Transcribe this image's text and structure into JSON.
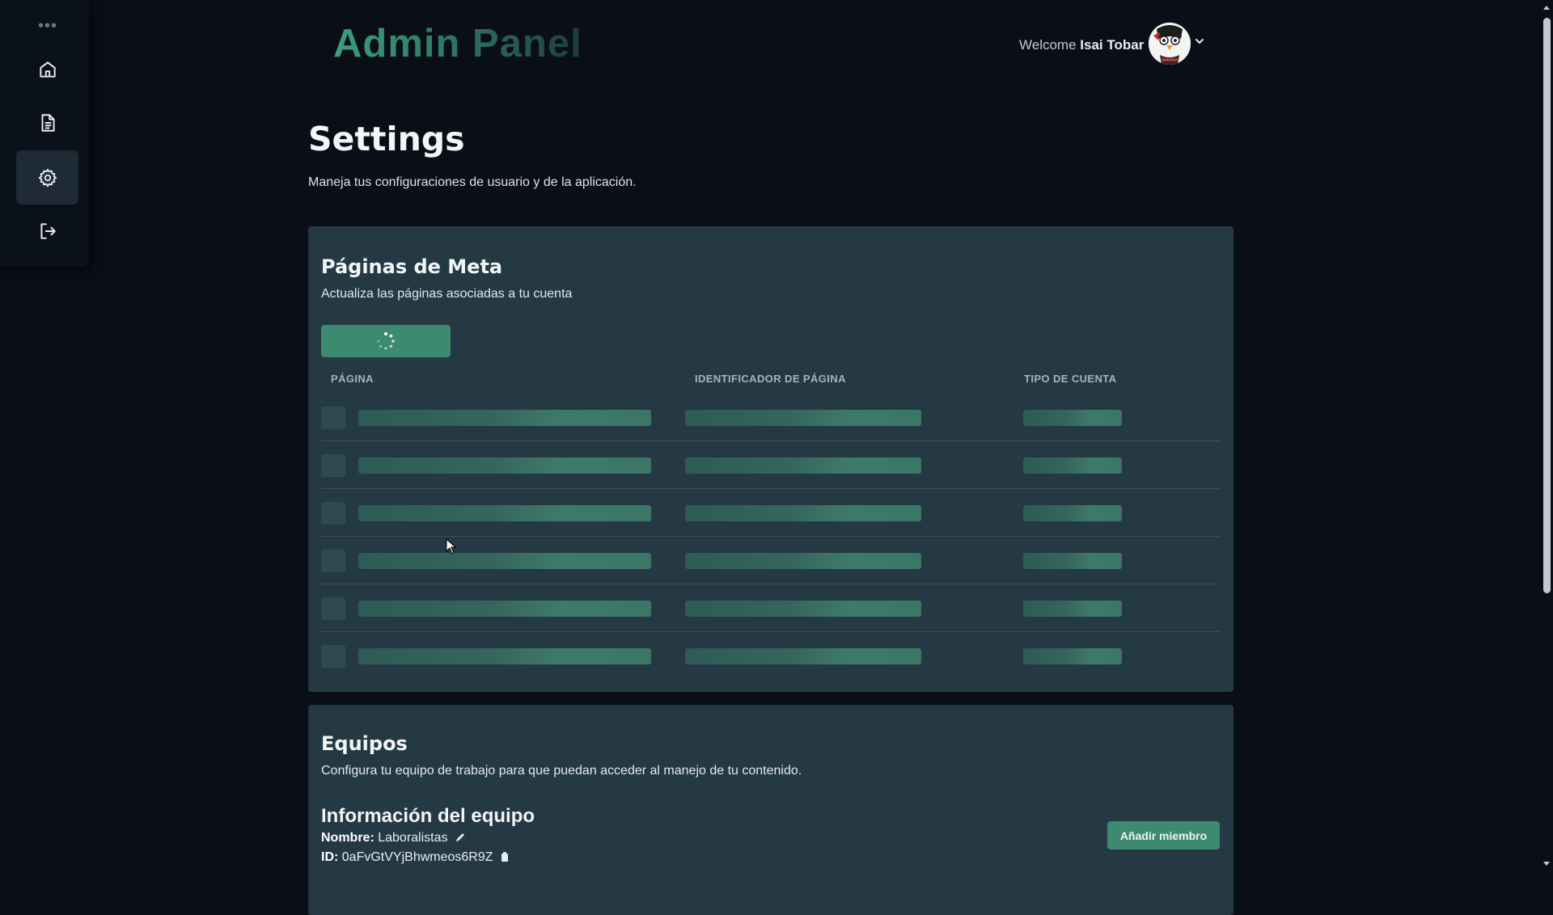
{
  "sidebar": {
    "more_label": "•••",
    "items": [
      {
        "name": "home",
        "icon": "home-icon"
      },
      {
        "name": "documents",
        "icon": "document-icon"
      },
      {
        "name": "settings",
        "icon": "gear-icon",
        "active": true
      },
      {
        "name": "logout",
        "icon": "logout-icon"
      }
    ]
  },
  "header": {
    "title": "Admin Panel",
    "welcome_prefix": "Welcome",
    "user_name": "Isai Tobar"
  },
  "page": {
    "title": "Settings",
    "subtitle": "Maneja tus configuraciones de usuario y de la aplicación."
  },
  "meta_pages": {
    "title": "Páginas de Meta",
    "description": "Actualiza las páginas asociadas a tu cuenta",
    "columns": [
      "PÁGINA",
      "IDENTIFICADOR DE PÁGINA",
      "TIPO DE CUENTA"
    ],
    "loading_rows": 6
  },
  "teams": {
    "title": "Equipos",
    "description": "Configura tu equipo de trabajo para que puedan acceder al manejo de tu contenido.",
    "info_title": "Información del equipo",
    "name_label": "Nombre:",
    "name_value": "Laboralistas",
    "id_label": "ID:",
    "id_value": "0aFvGtVYjBhwmeos6R9Z",
    "add_member_label": "Añadir miembro"
  },
  "colors": {
    "background": "#0a0f17",
    "card": "#253945",
    "accent": "#3e8a70"
  }
}
